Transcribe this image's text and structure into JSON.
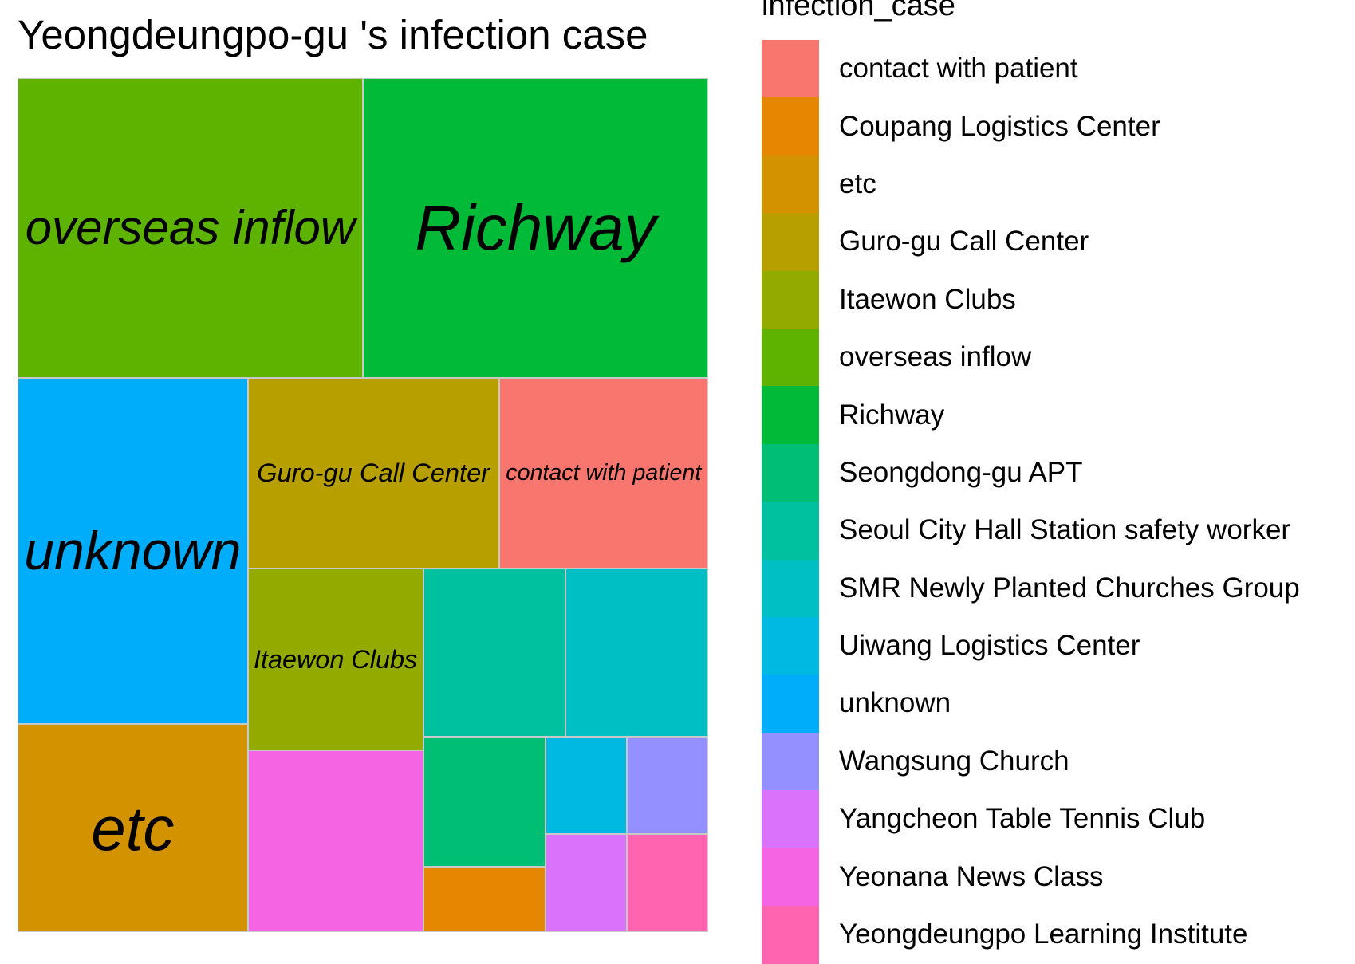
{
  "chart_data": {
    "type": "treemap",
    "title": "Yeongdeungpo-gu 's infection case",
    "legend_title": "infection_case",
    "legend_placement": "right",
    "categories": [
      {
        "name": "contact with patient",
        "value": 5,
        "color": "#F8766D",
        "label_shown": true
      },
      {
        "name": "Coupang Logistics Center",
        "value": 1,
        "color": "#E58700",
        "label_shown": false
      },
      {
        "name": "etc",
        "value": 6,
        "color": "#D39200",
        "label_shown": true
      },
      {
        "name": "Guro-gu Call Center",
        "value": 6,
        "color": "#B79F00",
        "label_shown": true
      },
      {
        "name": "Itaewon Clubs",
        "value": 4,
        "color": "#93AA00",
        "label_shown": true
      },
      {
        "name": "overseas inflow",
        "value": 13,
        "color": "#5EB300",
        "label_shown": true
      },
      {
        "name": "Richway",
        "value": 13,
        "color": "#00BA38",
        "label_shown": true
      },
      {
        "name": "Seongdong-gu APT",
        "value": 2,
        "color": "#00BF74",
        "label_shown": false
      },
      {
        "name": "Seoul City Hall Station safety worker",
        "value": 3,
        "color": "#00C19F",
        "label_shown": false
      },
      {
        "name": "SMR Newly Planted Churches Group",
        "value": 3,
        "color": "#00BFC4",
        "label_shown": false
      },
      {
        "name": "Uiwang Logistics Center",
        "value": 1,
        "color": "#00B9E3",
        "label_shown": false
      },
      {
        "name": "unknown",
        "value": 10,
        "color": "#00ADFA",
        "label_shown": true
      },
      {
        "name": "Wangsung Church",
        "value": 1,
        "color": "#9590FF",
        "label_shown": false
      },
      {
        "name": "Yangcheon Table Tennis Club",
        "value": 1,
        "color": "#DB72FB",
        "label_shown": false
      },
      {
        "name": "Yeonana News Class",
        "value": 4,
        "color": "#F564E3",
        "label_shown": false
      },
      {
        "name": "Yeongdeungpo Learning Institute",
        "value": 1,
        "color": "#FF64B0",
        "label_shown": false
      }
    ]
  }
}
